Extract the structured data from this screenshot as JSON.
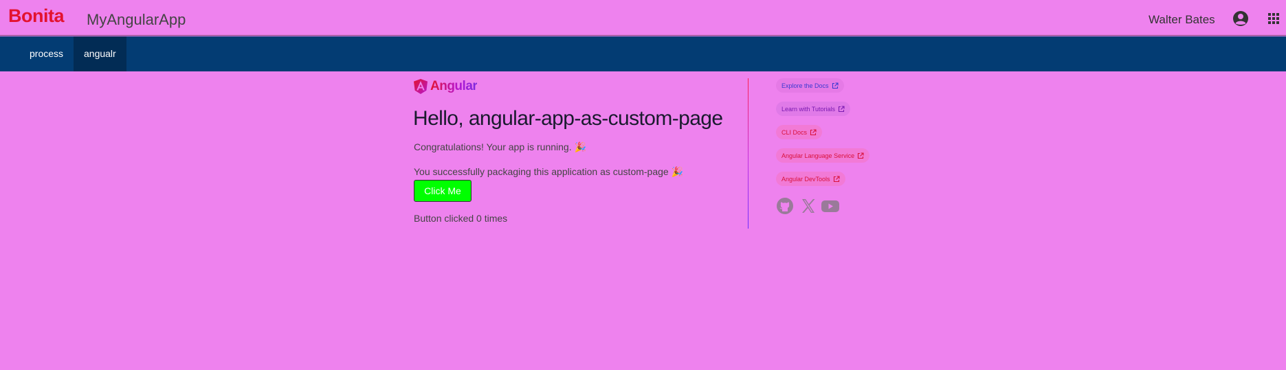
{
  "header": {
    "brand": "Bonita",
    "app_name": "MyAngularApp",
    "user_name": "Walter Bates",
    "icons": [
      "user-circle-icon",
      "apps-grid-icon"
    ]
  },
  "nav": {
    "items": [
      {
        "label": "process",
        "active": false
      },
      {
        "label": "angualr",
        "active": true
      }
    ]
  },
  "main": {
    "logo_text": "Angular",
    "title": "Hello, angular-app-as-custom-page",
    "congrats": "Congratulations! Your app is running. 🎉",
    "packaging": "You successfully packaging this application as custom-page 🎉",
    "button_label": "Click Me",
    "counter_text": "Button clicked 0 times"
  },
  "links": [
    {
      "label": "Explore the Docs",
      "color": "#3a3ad0"
    },
    {
      "label": "Learn with Tutorials",
      "color": "#7a1ab0"
    },
    {
      "label": "CLI Docs",
      "color": "#d8123a"
    },
    {
      "label": "Angular Language Service",
      "color": "#d8123a"
    },
    {
      "label": "Angular DevTools",
      "color": "#d8123a"
    }
  ],
  "social": [
    "github-icon",
    "x-icon",
    "youtube-icon"
  ],
  "colors": {
    "background": "#ee82ee",
    "navbar": "#033c73",
    "navbar_active": "#022c55",
    "brand": "#e3122f",
    "button": "#00ff00"
  }
}
